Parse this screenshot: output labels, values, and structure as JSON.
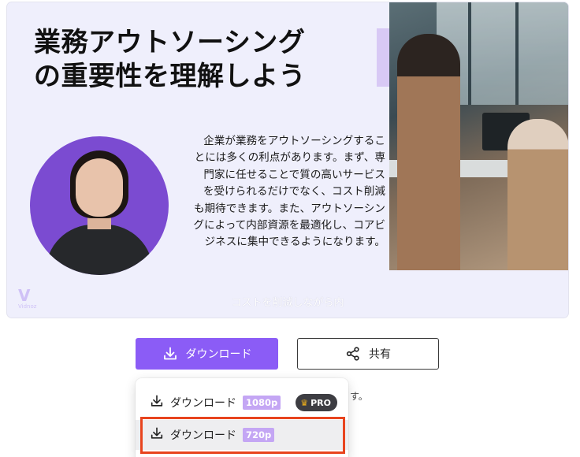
{
  "preview": {
    "headline_line1": "業務アウトソーシング",
    "headline_line2": "の重要性を理解しよう",
    "body": "企業が業務をアウトソーシングすることには多くの利点があります。まず、専門家に任せることで質の高いサービスを受けられるだけでなく、コスト削減も期待できます。また、アウトソーシングによって内部資源を最適化し、コアビジネスに集中できるようになります。",
    "caption": "コストを削減しながら内",
    "logo_mark": "V",
    "logo_word": "Vidnoz",
    "colors": {
      "background": "#efeffc",
      "avatar_bg": "#7b4bd1",
      "accent_bar": "#d8c9f5"
    }
  },
  "actions": {
    "download_label": "ダウンロード",
    "share_label": "共有",
    "download_icon": "download-icon",
    "share_icon": "share-icon",
    "accent": "#8b5cf6"
  },
  "behind_menu_text": "す。",
  "download_menu": {
    "items": [
      {
        "label": "ダウンロード",
        "resolution": "1080p",
        "badge": "PRO",
        "badge_icon": "crown-icon"
      },
      {
        "label": "ダウンロード",
        "resolution": "720p"
      }
    ],
    "highlight_color": "#e8441e"
  }
}
